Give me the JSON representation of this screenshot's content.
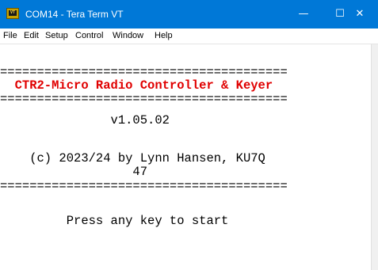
{
  "window": {
    "title": "COM14 - Tera Term VT",
    "icon_label": "VT",
    "controls": {
      "minimize": "—",
      "maximize": "☐",
      "close": "✕"
    }
  },
  "menubar": {
    "items": [
      "File",
      "Edit",
      "Setup",
      "Control",
      "Window",
      "Help"
    ]
  },
  "terminal": {
    "lines": [
      "=======================================",
      "  CTR2-Micro Radio Controller & Keyer",
      "=======================================",
      "               v1.05.02",
      "",
      "    (c) 2023/24 by Lynn Hansen, KU7Q",
      "                  47",
      "=======================================",
      "",
      "",
      "         Press any key to start"
    ]
  },
  "colors": {
    "titlebar": "#0078d7",
    "heading_text": "#e00000"
  }
}
